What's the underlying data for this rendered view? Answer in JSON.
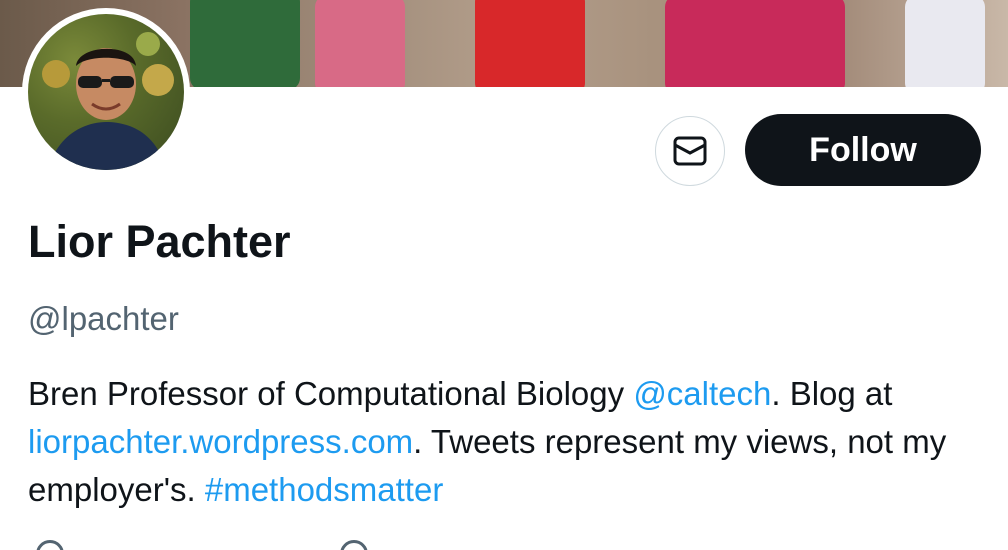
{
  "profile": {
    "name": "Lior Pachter",
    "handle": "@lpachter",
    "bio": {
      "part1": "Bren Professor of Computational Biology ",
      "mention": "@caltech",
      "part2": ". Blog at ",
      "website": "liorpachter.wordpress.com",
      "part3": ". Tweets represent my views, not my employer's. ",
      "hashtag": "#methodsmatter"
    }
  },
  "actions": {
    "message_icon": "envelope-icon",
    "follow_label": "Follow"
  },
  "colors": {
    "link": "#1d9bf0",
    "text": "#0f1419",
    "secondary": "#536471",
    "button_bg": "#0f1419"
  }
}
